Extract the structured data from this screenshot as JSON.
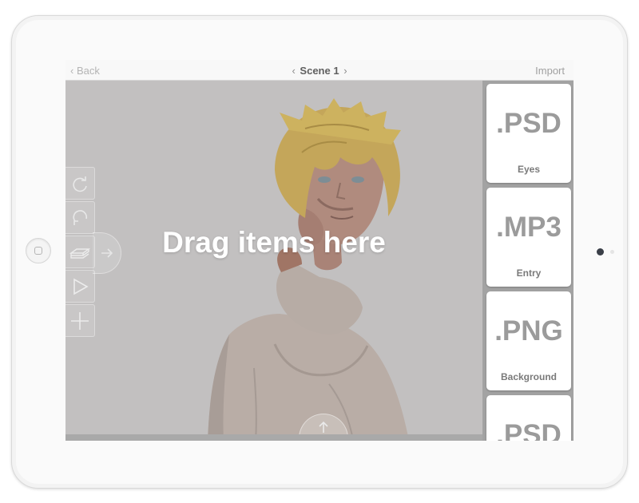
{
  "navbar": {
    "back_label": "Back",
    "title": "Scene 1",
    "prev_arrow": "‹",
    "next_arrow": "›",
    "import_label": "Import"
  },
  "canvas": {
    "drop_label": "Drag items here"
  },
  "toolbar": {
    "tools": [
      "redo-icon",
      "undo-icon",
      "layers-icon",
      "play-icon",
      "add-icon"
    ],
    "expand_icon": "arrow-right-icon"
  },
  "assets": [
    {
      "ext": ".PSD",
      "name": "Eyes"
    },
    {
      "ext": ".MP3",
      "name": "Entry"
    },
    {
      "ext": ".PNG",
      "name": "Background"
    },
    {
      "ext": ".PSD",
      "name": ""
    }
  ],
  "colors": {
    "canvas_bg": "#c2c0c0",
    "sidebar_bg": "#a3a3a3",
    "ext_text": "#9b9b9b"
  }
}
